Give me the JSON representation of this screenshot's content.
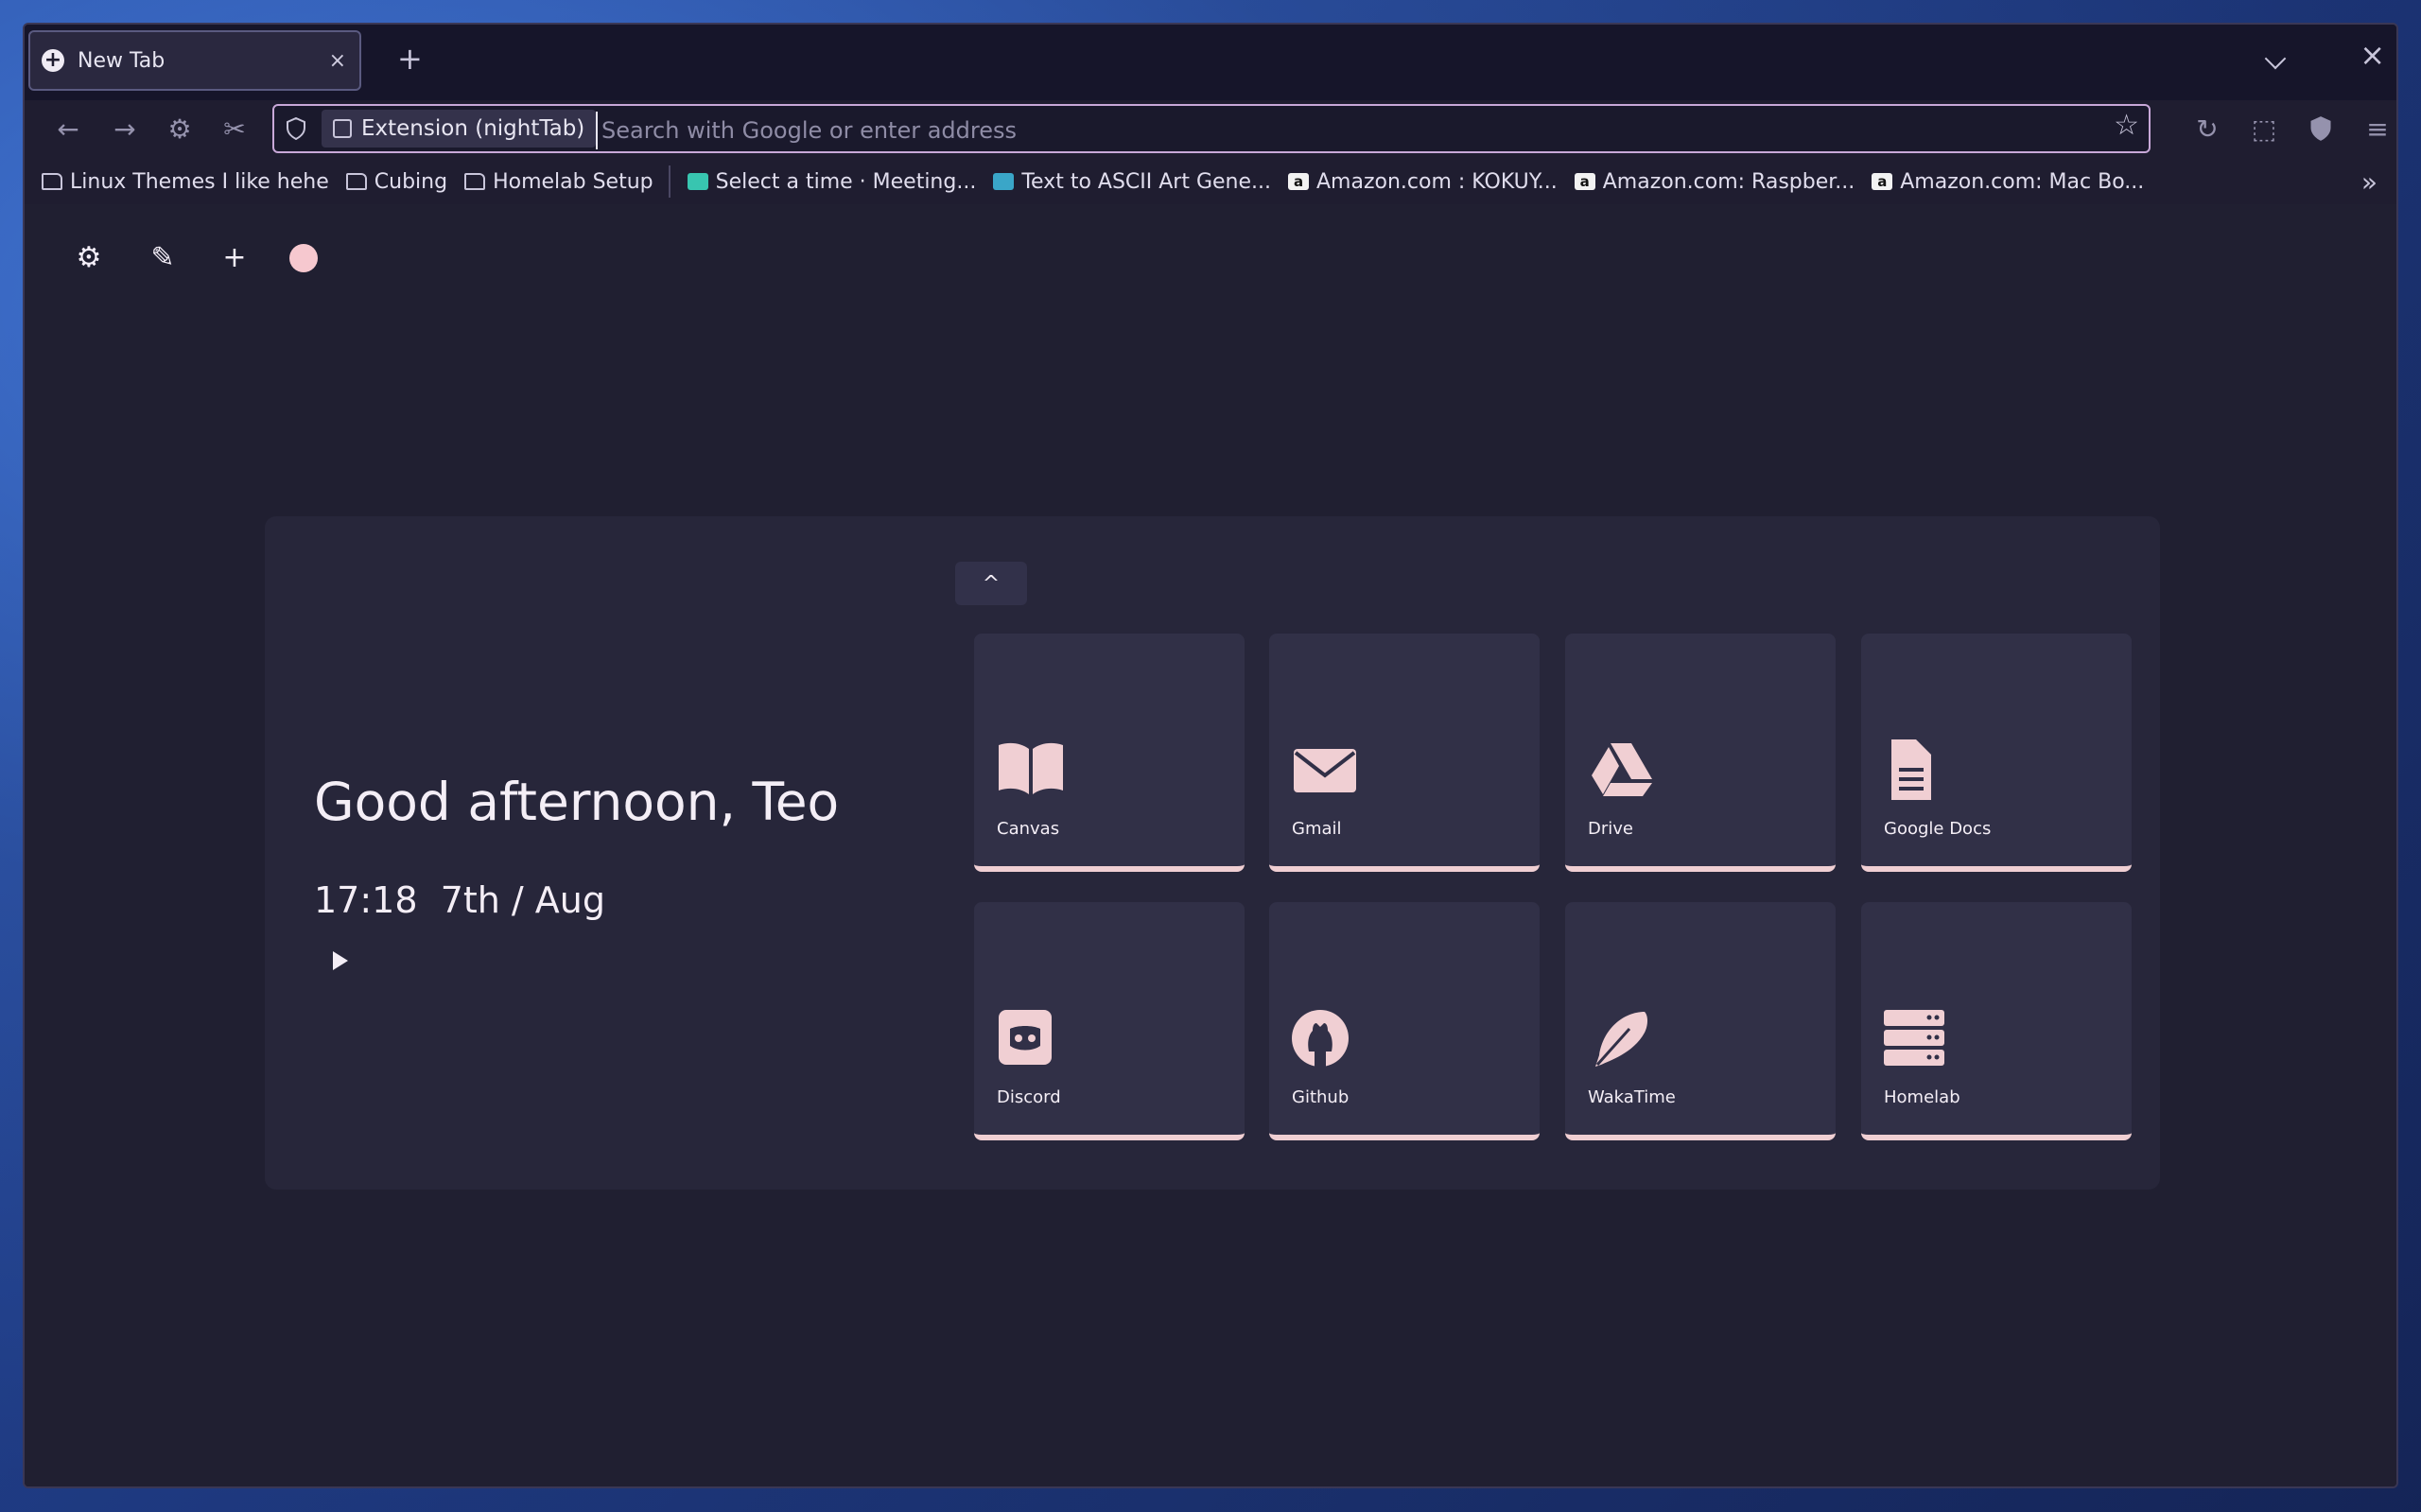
{
  "tab": {
    "title": "New Tab",
    "close": "×"
  },
  "toolbar": {
    "new_tab": "+",
    "window_close": "×"
  },
  "urlbar": {
    "identity_label": "Extension (nightTab)",
    "placeholder": "Search with Google or enter address"
  },
  "bookmarks": [
    {
      "label": "Linux Themes I like hehe",
      "type": "folder"
    },
    {
      "label": "Cubing",
      "type": "folder"
    },
    {
      "label": "Homelab Setup",
      "type": "folder"
    },
    {
      "label": "Select a time · Meeting...",
      "type": "site"
    },
    {
      "label": "Text to ASCII Art Gene...",
      "type": "site"
    },
    {
      "label": "Amazon.com : KOKUY...",
      "type": "site"
    },
    {
      "label": "Amazon.com: Raspber...",
      "type": "site"
    },
    {
      "label": "Amazon.com: Mac Bo...",
      "type": "site"
    }
  ],
  "page": {
    "greeting": "Good afternoon, Teo",
    "time": "17:18",
    "date": "7th / Aug",
    "tiles": [
      {
        "label": "Canvas",
        "icon": "book-icon"
      },
      {
        "label": "Gmail",
        "icon": "envelope-icon"
      },
      {
        "label": "Drive",
        "icon": "drive-icon"
      },
      {
        "label": "Google Docs",
        "icon": "document-icon"
      },
      {
        "label": "Discord",
        "icon": "discord-icon"
      },
      {
        "label": "Github",
        "icon": "github-icon"
      },
      {
        "label": "WakaTime",
        "icon": "feather-icon"
      },
      {
        "label": "Homelab",
        "icon": "server-icon"
      }
    ]
  },
  "colors": {
    "accent": "#f0cfd3",
    "background": "#201f31",
    "tile": "#313047"
  }
}
